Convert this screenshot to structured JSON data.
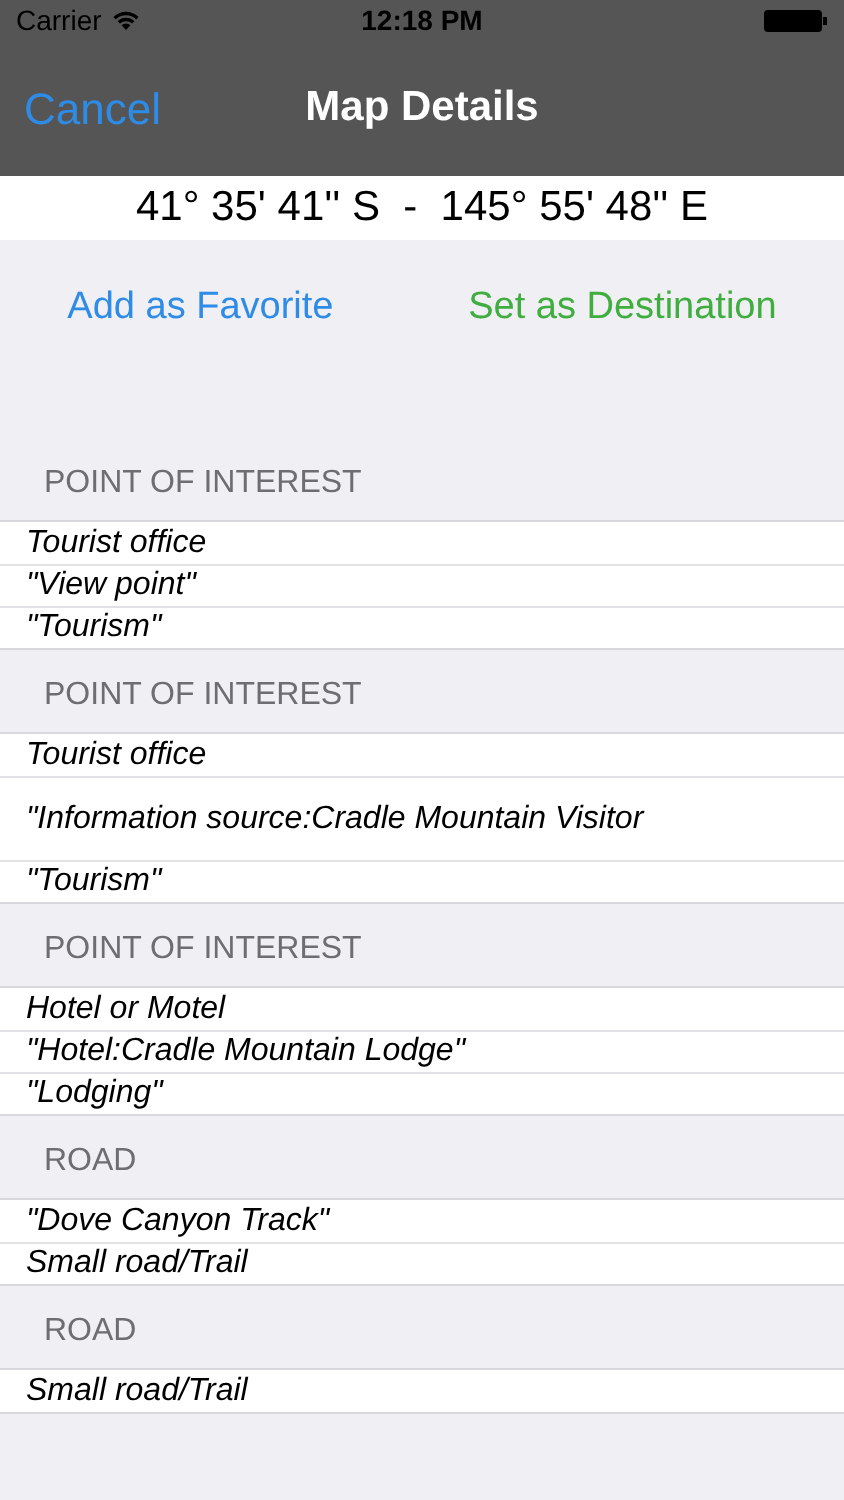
{
  "status_bar": {
    "carrier": "Carrier",
    "time": "12:18 PM"
  },
  "nav_bar": {
    "cancel": "Cancel",
    "title": "Map Details"
  },
  "coordinates": "41° 35' 41'' S  -  145° 55' 48'' E",
  "actions": [
    {
      "label": "Add as Favorite",
      "color": "#2f8ce6"
    },
    {
      "label": "Set as Destination",
      "color": "#3fae3f"
    }
  ],
  "sections": [
    {
      "header": "POINT OF INTEREST",
      "rows": [
        {
          "text": "Tourist office",
          "kind": "single"
        },
        {
          "text": "\"View point\"",
          "kind": "single"
        },
        {
          "text": "\"Tourism\"",
          "kind": "single"
        }
      ]
    },
    {
      "header": "POINT OF INTEREST",
      "rows": [
        {
          "text": "Tourist office",
          "kind": "single"
        },
        {
          "text": "\"Information source:Cradle Mountain Visitor",
          "kind": "tall"
        },
        {
          "text": "\"Tourism\"",
          "kind": "single"
        }
      ]
    },
    {
      "header": "POINT OF INTEREST",
      "rows": [
        {
          "text": "Hotel or Motel",
          "kind": "single"
        },
        {
          "text": "\"Hotel:Cradle Mountain Lodge\"",
          "kind": "single"
        },
        {
          "text": "\"Lodging\"",
          "kind": "single"
        }
      ]
    },
    {
      "header": "ROAD",
      "rows": [
        {
          "text": "\"Dove Canyon Track\"",
          "kind": "single"
        },
        {
          "text": "Small road/Trail",
          "kind": "single"
        }
      ]
    },
    {
      "header": "ROAD",
      "rows": [
        {
          "text": "Small road/Trail",
          "kind": "single"
        }
      ]
    }
  ]
}
